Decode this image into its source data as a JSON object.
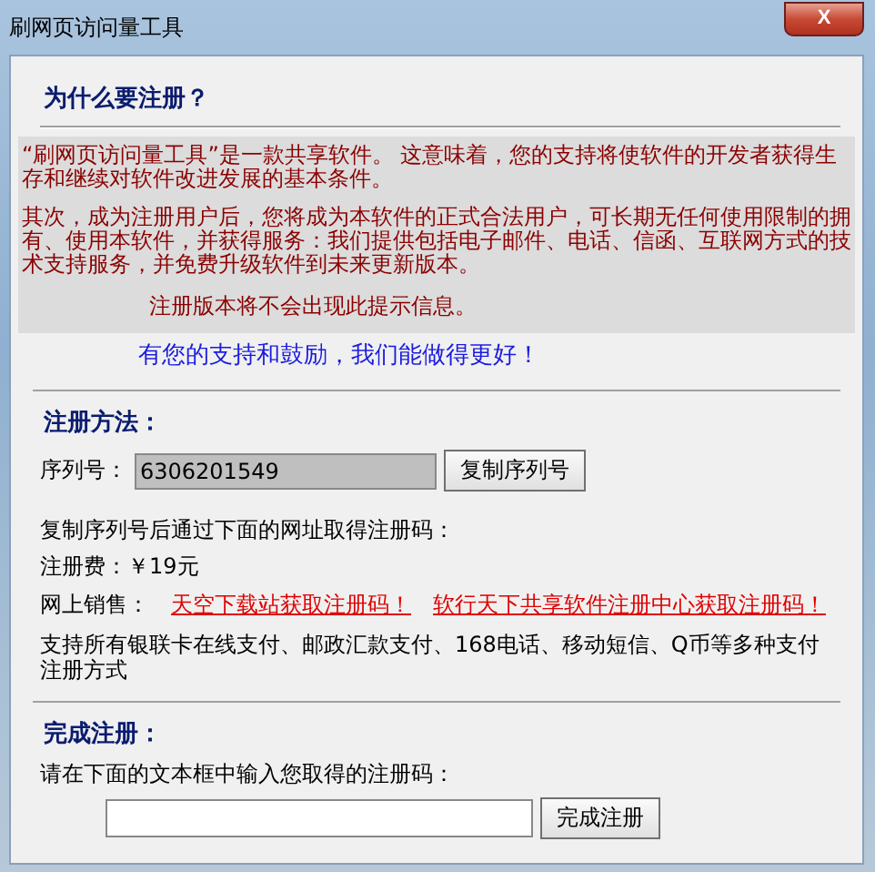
{
  "window": {
    "title": "刷网页访问量工具",
    "close": "X"
  },
  "why": {
    "heading": "为什么要注册？",
    "paragraphs": [
      "“刷网页访问量工具”是一款共享软件。 这意味着，您的支持将使软件的开发者获得生存和继续对软件改进发展的基本条件。",
      "其次，成为注册用户后，您将成为本软件的正式合法用户，可长期无任何使用限制的拥有、使用本软件，并获得服务：我们提供包括电子邮件、电话、信函、互联网方式的技术支持服务，并免费升级软件到未来更新版本。"
    ],
    "notice": "注册版本将不会出现此提示信息。",
    "thanks": "有您的支持和鼓励，我们能做得更好！"
  },
  "method": {
    "heading": "注册方法：",
    "serial_label": "序列号：",
    "serial": "6306201549",
    "copy_button": "复制序列号",
    "instruction": "复制序列号后通过下面的网址取得注册码：",
    "fee": "注册费：￥19元",
    "sales_label": "网上销售：",
    "links": [
      "天空下载站获取注册码！",
      "软行天下共享软件注册中心获取注册码！"
    ],
    "payment": "支持所有银联卡在线支付、邮政汇款支付、168电话、移动短信、Q币等多种支付注册方式"
  },
  "finish": {
    "heading": "完成注册：",
    "prompt": "请在下面的文本框中输入您取得的注册码：",
    "button": "完成注册"
  }
}
